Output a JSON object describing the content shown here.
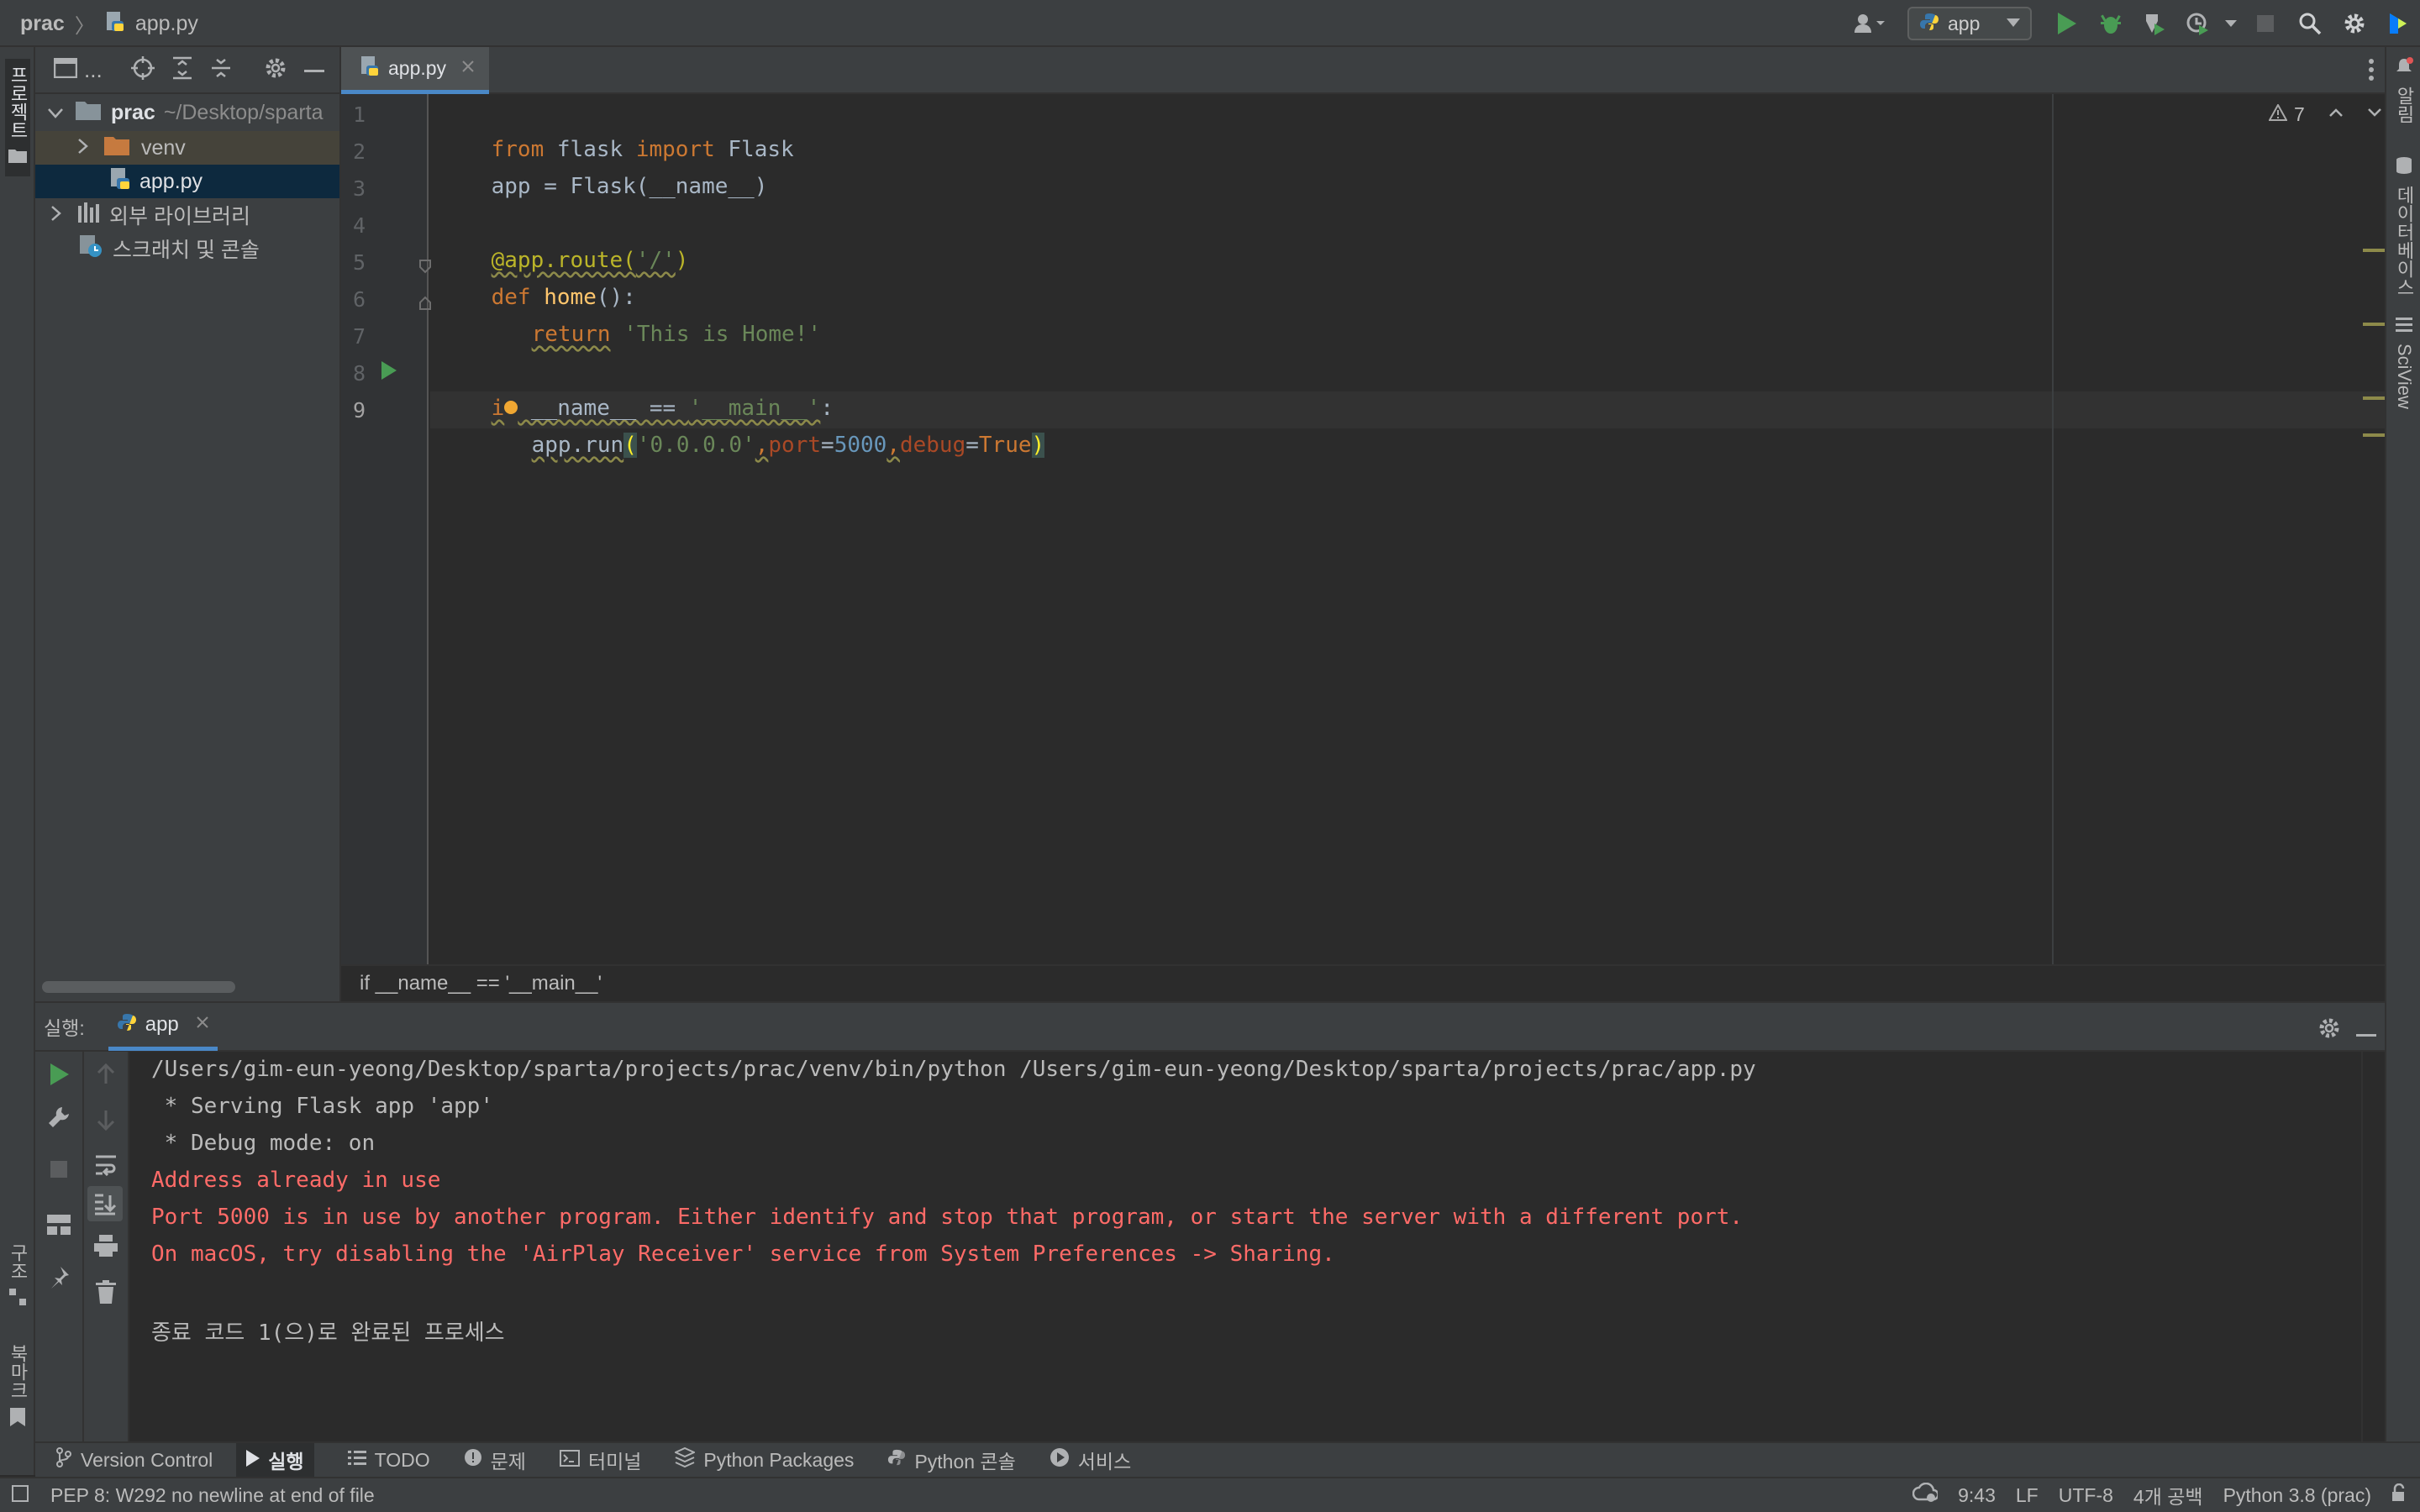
{
  "titlebar": {
    "project": "prac",
    "file": "app.py",
    "run_config": "app"
  },
  "left_strip": {
    "project_label": "프로젝트",
    "structure_label": "구조",
    "bookmarks_label": "북마크"
  },
  "right_strip": {
    "notifications_label": "알림",
    "database_label": "데이터베이스",
    "sciview_label": "SciView"
  },
  "project_panel": {
    "toolbar_label": "...",
    "root_name": "prac",
    "root_path": "~/Desktop/sparta",
    "items": [
      {
        "label": "venv"
      },
      {
        "label": "app.py"
      },
      {
        "label": "외부 라이브러리"
      },
      {
        "label": "스크래치 및 콘솔"
      }
    ]
  },
  "editor": {
    "tab_label": "app.py",
    "warning_count": "7",
    "line_numbers": [
      "1",
      "2",
      "3",
      "4",
      "5",
      "6",
      "7",
      "8",
      "9"
    ],
    "lines": {
      "l1": {
        "a": "from",
        "b": " flask ",
        "c": "import",
        "d": " Flask"
      },
      "l2": {
        "a": "app = Flask(__name__)"
      },
      "l4": {
        "a": "@app.route(",
        "b": "'/'",
        "c": ")"
      },
      "l5": {
        "a": "def",
        "b": " ",
        "c": "home",
        "d": "():"
      },
      "l6": {
        "a": "return",
        "b": " ",
        "c": "'This is Home!'"
      },
      "l8": {
        "a": "i",
        "b": "f",
        "c": " __name__ == ",
        "d": "'__main__'",
        "e": ":"
      },
      "l9": {
        "a": "app.run",
        "b": "(",
        "c": "'0.0.0.0'",
        "d": ",",
        "e": "port",
        "f": "=",
        "g": "5000",
        "h": ",",
        "i": "debug",
        "j": "=",
        "k": "True",
        "l": ")"
      }
    },
    "breadcrumb": "if __name__ == '__main__'"
  },
  "run_panel": {
    "label": "실행:",
    "tab_label": "app",
    "console": {
      "cmd": "/Users/gim-eun-yeong/Desktop/sparta/projects/prac/venv/bin/python /Users/gim-eun-yeong/Desktop/sparta/projects/prac/app.py",
      "serving": " * Serving Flask app 'app'",
      "debug": " * Debug mode: on",
      "err1": "Address already in use",
      "err2": "Port 5000 is in use by another program. Either identify and stop that program, or start the server with a different port.",
      "err3": "On macOS, try disabling the 'AirPlay Receiver' service from System Preferences -> Sharing.",
      "exit": "종료 코드 1(으)로 완료된 프로세스"
    }
  },
  "bottom_tabs": [
    {
      "label": "Version Control"
    },
    {
      "label": "실행"
    },
    {
      "label": "TODO"
    },
    {
      "label": "문제"
    },
    {
      "label": "터미널"
    },
    {
      "label": "Python Packages"
    },
    {
      "label": "Python 콘솔"
    },
    {
      "label": "서비스"
    }
  ],
  "statusbar": {
    "message": "PEP 8: W292 no newline at end of file",
    "position": "9:43",
    "line_sep": "LF",
    "encoding": "UTF-8",
    "indent": "4개 공백",
    "interpreter": "Python 3.8 (prac)"
  },
  "colors": {
    "keyword": "#cc7832",
    "string": "#6a8759",
    "decorator": "#bbb529",
    "function": "#ffc66d",
    "number": "#6897bb",
    "error": "#ff6b68",
    "run_green": "#499c54"
  }
}
